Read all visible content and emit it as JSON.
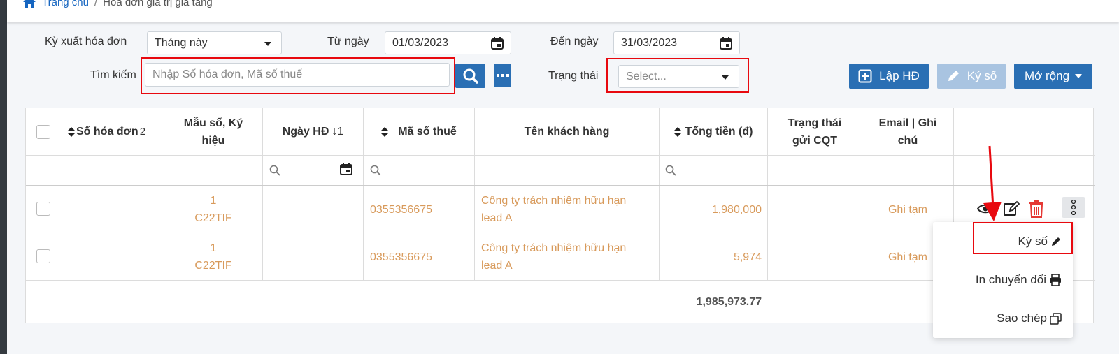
{
  "breadcrumb": {
    "home": "Trang chủ",
    "separator": "/",
    "current": "Hóa đơn giá trị gia tăng"
  },
  "filters": {
    "period_label": "Kỳ xuất hóa đơn",
    "period_value": "Tháng này",
    "from_label": "Từ ngày",
    "from_value": "01/03/2023",
    "to_label": "Đến ngày",
    "to_value": "31/03/2023",
    "search_label": "Tìm kiếm",
    "search_placeholder": "Nhập Số hóa đơn, Mã số thuế",
    "status_label": "Trạng thái",
    "status_placeholder": "Select..."
  },
  "toolbar": {
    "create_label": "Lập HĐ",
    "sign_label": "Ký số",
    "expand_label": "Mở rộng"
  },
  "table": {
    "headers": {
      "invoice_no": "Số hóa đơn",
      "invoice_no_sort": "2",
      "template_line1": "Mẫu số, Ký",
      "template_line2": "hiệu",
      "date": "Ngày HĐ",
      "date_sort": "↓1",
      "tax_code": "Mã số thuế",
      "customer": "Tên khách hàng",
      "total": "Tổng tiền (đ)",
      "cqt_line1": "Trạng thái",
      "cqt_line2": "gửi CQT",
      "email_line1": "Email | Ghi",
      "email_line2": "chú"
    },
    "rows": [
      {
        "template_no": "1",
        "symbol": "C22TIF",
        "tax_code": "0355356675",
        "customer_line1": "Công ty trách nhiệm hữu hạn",
        "customer_line2": "lead A",
        "total": "1,980,000",
        "note": "Ghi tạm"
      },
      {
        "template_no": "1",
        "symbol": "C22TIF",
        "tax_code": "0355356675",
        "customer_line1": "Công ty trách nhiệm hữu hạn",
        "customer_line2": "lead A",
        "total": "5,974",
        "note": "Ghi tạm"
      }
    ],
    "grand_total": "1,985,973.77"
  },
  "context_menu": {
    "sign": "Ký số",
    "print_convert": "In chuyển đổi",
    "copy": "Sao chép"
  },
  "colors": {
    "primary": "#2a6fb4",
    "highlight_red": "#e8090f",
    "cell_text": "#d89a5b",
    "delete_red": "#e53935"
  }
}
